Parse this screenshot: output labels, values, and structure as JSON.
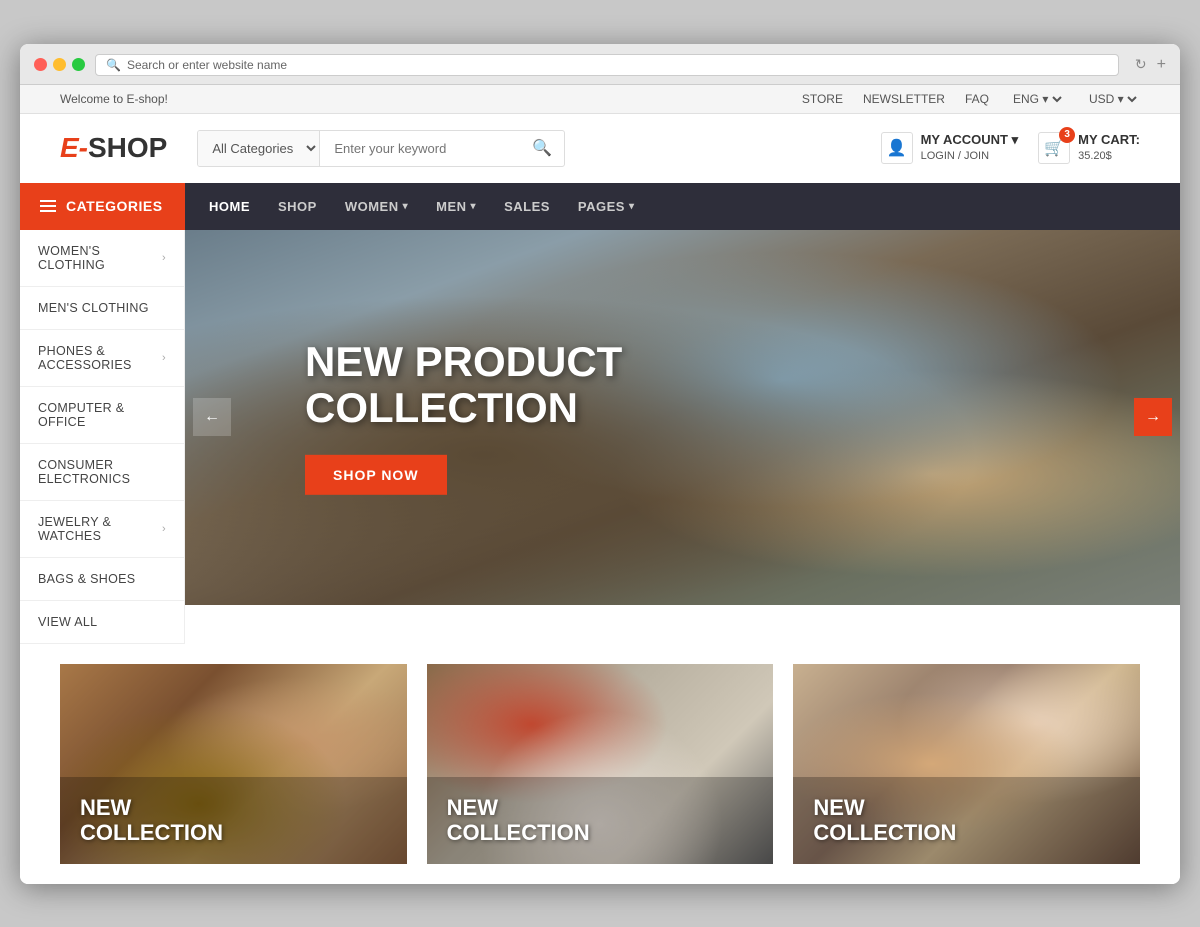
{
  "browser": {
    "address": "Search or enter website name"
  },
  "topbar": {
    "welcome": "Welcome to E-shop!",
    "links": [
      "STORE",
      "NEWSLETTER",
      "FAQ"
    ],
    "lang": "ENG",
    "currency": "USD"
  },
  "header": {
    "logo_e": "E-",
    "logo_shop": "SHOP",
    "category_placeholder": "All Categories",
    "search_placeholder": "Enter your keyword",
    "account_label": "MY ACCOUNT",
    "account_sub": "LOGIN / JOIN",
    "cart_label": "MY CART:",
    "cart_price": "35.20$",
    "cart_count": "3"
  },
  "navbar": {
    "categories_label": "CATEGORIES",
    "links": [
      {
        "label": "HOME",
        "has_arrow": false
      },
      {
        "label": "SHOP",
        "has_arrow": false
      },
      {
        "label": "WOMEN",
        "has_arrow": true
      },
      {
        "label": "MEN",
        "has_arrow": true
      },
      {
        "label": "SALES",
        "has_arrow": false
      },
      {
        "label": "PAGES",
        "has_arrow": true
      }
    ]
  },
  "sidebar": {
    "items": [
      {
        "label": "WOMEN'S CLOTHING",
        "has_arrow": true
      },
      {
        "label": "MEN'S CLOTHING",
        "has_arrow": false
      },
      {
        "label": "PHONES & ACCESSORIES",
        "has_arrow": true
      },
      {
        "label": "COMPUTER & OFFICE",
        "has_arrow": false
      },
      {
        "label": "CONSUMER ELECTRONICS",
        "has_arrow": false
      },
      {
        "label": "JEWELRY & WATCHES",
        "has_arrow": true
      },
      {
        "label": "BAGS & SHOES",
        "has_arrow": false
      },
      {
        "label": "VIEW ALL",
        "has_arrow": false
      }
    ]
  },
  "hero": {
    "title_line1": "NEW PRODUCT",
    "title_line2": "COLLECTION",
    "shop_now": "SHOP NOW",
    "prev_icon": "←",
    "next_icon": "→"
  },
  "collections": [
    {
      "label_line1": "NEW",
      "label_line2": "COLLECTION"
    },
    {
      "label_line1": "NEW",
      "label_line2": "COLLECTION"
    },
    {
      "label_line1": "NEW",
      "label_line2": "COLLECTION"
    }
  ]
}
